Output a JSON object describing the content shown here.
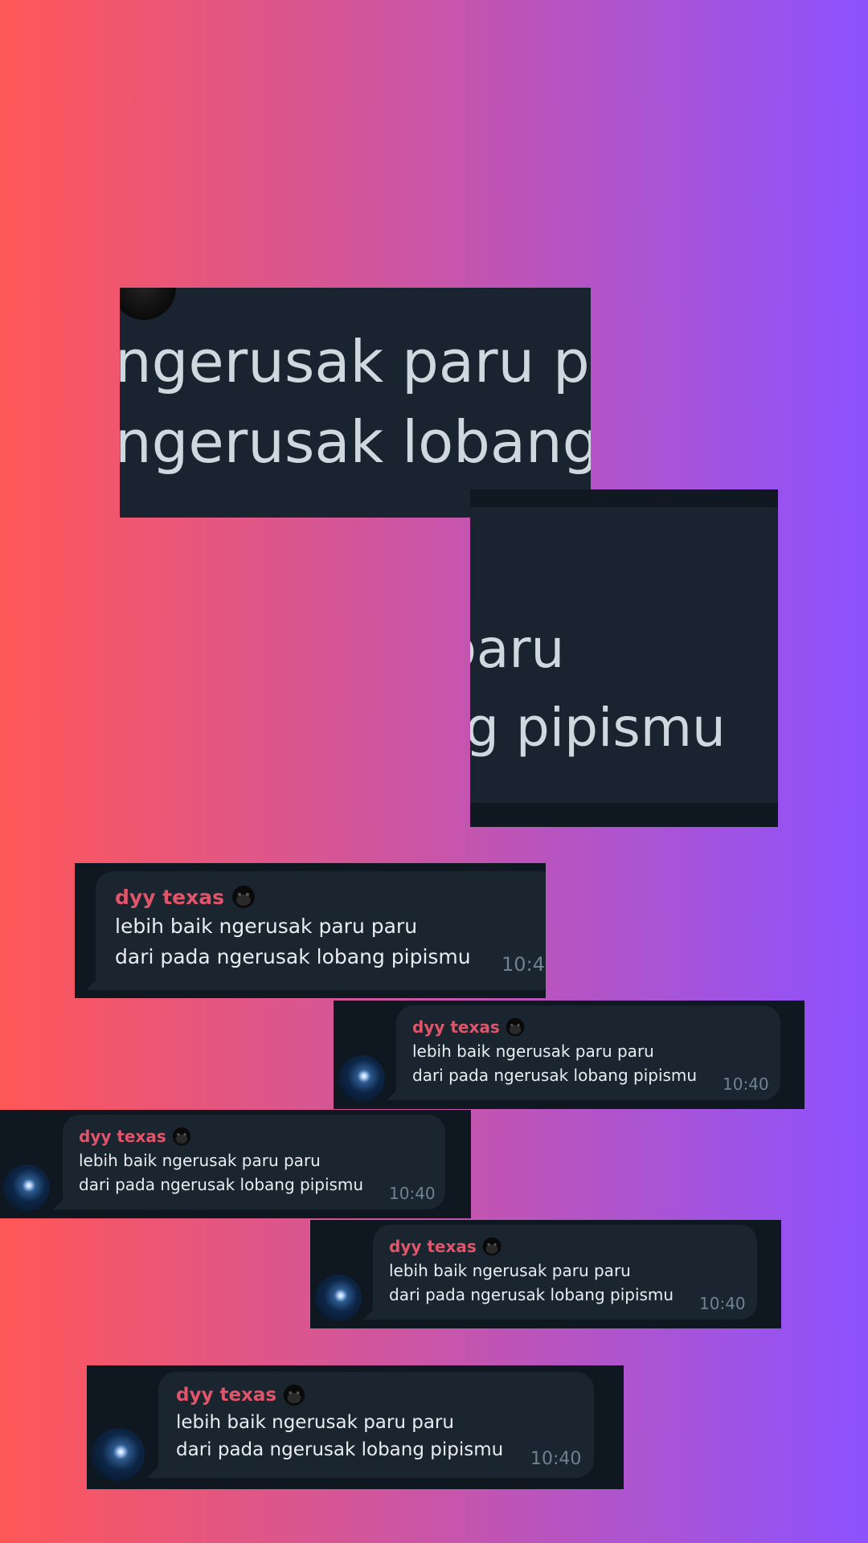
{
  "colors": {
    "background_left": "#ff5757",
    "background_right": "#8c52ff",
    "card": "#0f1720",
    "bubble": "#1a2530",
    "sender": "#e0556a",
    "message": "#e8edf2",
    "time": "#6f8292"
  },
  "zoom_crop_1": {
    "line1": "ngerusak paru pa",
    "line2": "ngerusak lobang"
  },
  "zoom_crop_2": {
    "line1": "paru",
    "line2": "g pipismu"
  },
  "message": {
    "sender": "dyy texas",
    "sender_icon": "gorilla-face-icon",
    "line1": "lebih baik ngerusak paru paru",
    "line2": "dari pada ngerusak lobang pipismu",
    "time": "10:40",
    "time_cropped": "10:4"
  }
}
